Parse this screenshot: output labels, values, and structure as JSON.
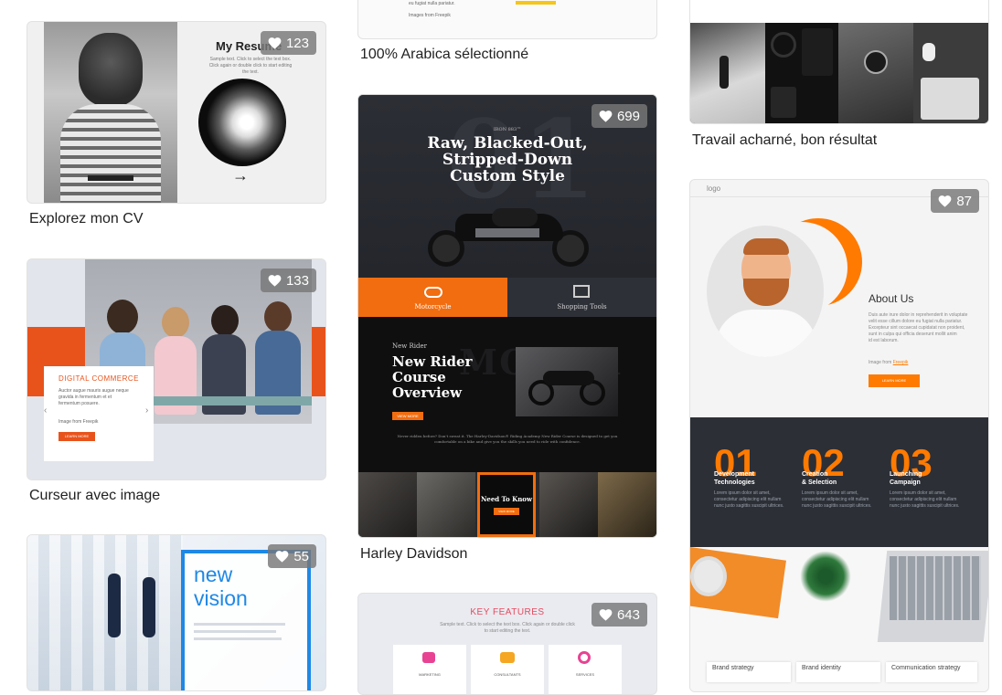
{
  "cards": [
    {
      "caption": "Explorez mon CV",
      "likes": "123",
      "preview": {
        "heading": "My Resume",
        "text_lines": [
          "Sample text. Click to select the text box.",
          "Click again or double click to start editing",
          "the text."
        ],
        "arrow": "→"
      }
    },
    {
      "caption": "Curseur avec image",
      "likes": "133",
      "preview": {
        "tag": "DIGITAL COMMERCE",
        "text_lines": [
          "Auctor augue mauris augue neque",
          "gravida in fermentum et et",
          "fermentum posuere."
        ],
        "credit": "Image from Freepik",
        "button": "LEARN MORE"
      }
    },
    {
      "caption": "",
      "likes": "55",
      "preview": {
        "heading_line1": "new",
        "heading_line2": "vision"
      }
    },
    {
      "caption": "100% Arabica sélectionné",
      "likes": "",
      "preview": {
        "text_lines": [
          "eu fugiat nulla pariatur.",
          "Images from Freepik"
        ]
      }
    },
    {
      "caption": "Harley Davidson",
      "likes": "699",
      "preview": {
        "kicker": "IRON 883™",
        "headline": [
          "Raw, Blacked-Out,",
          "Stripped-Down",
          "Custom Style"
        ],
        "tabs": [
          "Motorcycle",
          "Shopping Tools"
        ],
        "rider_kicker": "New Rider",
        "rider_title": [
          "New Rider",
          "Course",
          "Overview"
        ],
        "rider_button": "VIEW MORE",
        "rider_text": "Never ridden before? Don't sweat it. The Harley-Davidson® Riding Academy New Rider Course is designed to get you comfortable on a bike and give you the skills you need to ride with confidence.",
        "strip_title": "Need To Know",
        "strip_button": "VIEW MORE"
      }
    },
    {
      "caption": "",
      "likes": "643",
      "preview": {
        "heading": "KEY FEATURES",
        "text_lines": [
          "Sample text. Click to select the text box. Click again or double click",
          "to start editing the text."
        ],
        "features": [
          "MARKETING",
          "CONSULTANTS",
          "SERVICES"
        ]
      }
    },
    {
      "caption": "Travail acharné, bon résultat",
      "likes": ""
    },
    {
      "caption": "",
      "likes": "87",
      "preview": {
        "logo": "logo",
        "about_title": "About Us",
        "about_text": [
          "Duis aute irure dolor in reprehenderit in voluptate",
          "velit esse cillum dolore eu fugiat nulla pariatur.",
          "Excepteur sint occaecat cupidatat non proident,",
          "sunt in culpa qui officia deserunt mollit anim",
          "id est laborum."
        ],
        "credit_prefix": "Image from ",
        "credit_link": "Freepik",
        "button": "LEARN MORE",
        "steps": [
          {
            "num": "01",
            "title": [
              "Development",
              "Technologies"
            ]
          },
          {
            "num": "02",
            "title": [
              "Creation",
              "& Selection"
            ]
          },
          {
            "num": "03",
            "title": [
              "Launching",
              "Campaign"
            ]
          }
        ],
        "step_text": [
          "Lorem ipsum dolor sit amet,",
          "consectetur adipiscing elit nullam",
          "nunc justo sagittis suscipit ultrices."
        ],
        "services": [
          "Brand strategy",
          "Brand identity",
          "Communication strategy"
        ]
      }
    }
  ],
  "colors": {
    "accent_orange": "#ff7a00",
    "harley_orange": "#f26d0f",
    "dark_panel": "#2c2f36",
    "badge_bg": "#787878"
  }
}
